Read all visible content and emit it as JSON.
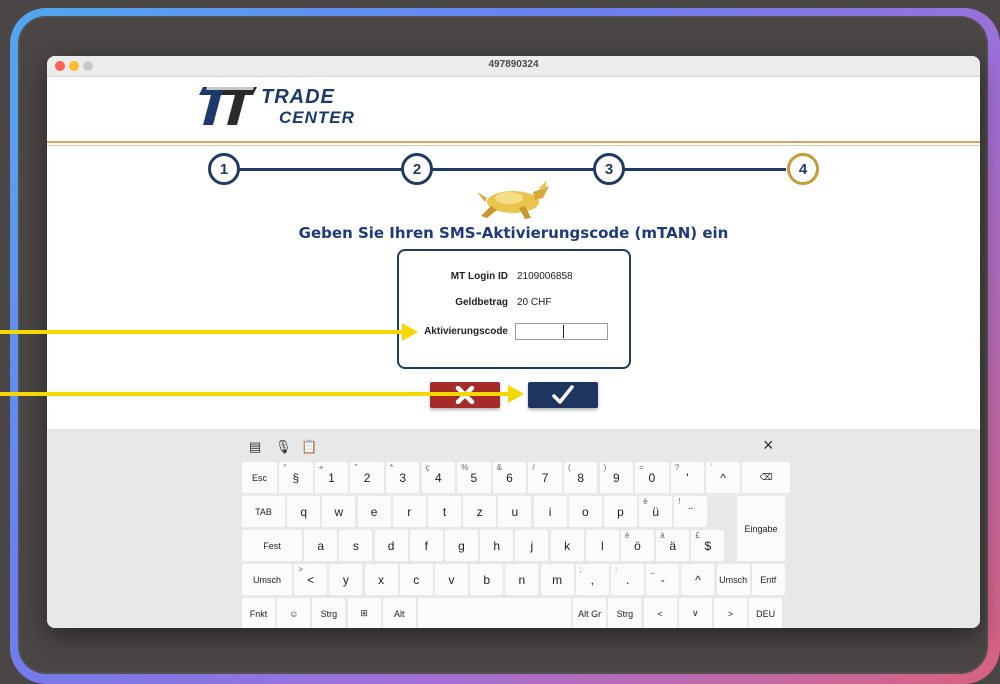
{
  "window": {
    "title": "497890324"
  },
  "logo": {
    "line1": "TRADE",
    "line2": "CENTER"
  },
  "steps": [
    "1",
    "2",
    "3",
    "4"
  ],
  "heading": "Geben Sie Ihren SMS-Aktivierungscode (mTAN) ein",
  "form": {
    "login_label": "MT Login ID",
    "login_value": "2109006858",
    "amount_label": "Geldbetrag",
    "amount_value": "20 CHF",
    "code_label": "Aktivierungscode",
    "code_value": ""
  },
  "buttons": {
    "cancel_icon": "x-icon",
    "confirm_icon": "checkmark-icon"
  },
  "keyboard": {
    "close": "×",
    "row1": [
      {
        "main": "Esc",
        "sec": ""
      },
      {
        "main": "§",
        "sec": "°"
      },
      {
        "main": "1",
        "sec": "+"
      },
      {
        "main": "2",
        "sec": "\""
      },
      {
        "main": "3",
        "sec": "*"
      },
      {
        "main": "4",
        "sec": "ç"
      },
      {
        "main": "5",
        "sec": "%"
      },
      {
        "main": "6",
        "sec": "&"
      },
      {
        "main": "7",
        "sec": "/"
      },
      {
        "main": "8",
        "sec": "("
      },
      {
        "main": "9",
        "sec": ")"
      },
      {
        "main": "0",
        "sec": "="
      },
      {
        "main": "'",
        "sec": "?"
      },
      {
        "main": "^",
        "sec": "`"
      },
      {
        "main": "⌫",
        "sec": ""
      }
    ],
    "row2": [
      {
        "main": "TAB",
        "sec": ""
      },
      {
        "main": "q",
        "sec": ""
      },
      {
        "main": "w",
        "sec": ""
      },
      {
        "main": "e",
        "sec": ""
      },
      {
        "main": "r",
        "sec": ""
      },
      {
        "main": "t",
        "sec": ""
      },
      {
        "main": "z",
        "sec": ""
      },
      {
        "main": "u",
        "sec": ""
      },
      {
        "main": "i",
        "sec": ""
      },
      {
        "main": "o",
        "sec": ""
      },
      {
        "main": "p",
        "sec": ""
      },
      {
        "main": "ü",
        "sec": "è"
      },
      {
        "main": "¨",
        "sec": "!"
      }
    ],
    "enter": "Eingabe",
    "row3": [
      {
        "main": "Fest",
        "sec": ""
      },
      {
        "main": "a",
        "sec": ""
      },
      {
        "main": "s",
        "sec": ""
      },
      {
        "main": "d",
        "sec": ""
      },
      {
        "main": "f",
        "sec": ""
      },
      {
        "main": "g",
        "sec": ""
      },
      {
        "main": "h",
        "sec": ""
      },
      {
        "main": "j",
        "sec": ""
      },
      {
        "main": "k",
        "sec": ""
      },
      {
        "main": "l",
        "sec": ""
      },
      {
        "main": "ö",
        "sec": "é"
      },
      {
        "main": "ä",
        "sec": "à"
      },
      {
        "main": "$",
        "sec": "£"
      }
    ],
    "row4": [
      {
        "main": "Umsch",
        "sec": ""
      },
      {
        "main": "<",
        "sec": ">"
      },
      {
        "main": "y",
        "sec": ""
      },
      {
        "main": "x",
        "sec": ""
      },
      {
        "main": "c",
        "sec": ""
      },
      {
        "main": "v",
        "sec": ""
      },
      {
        "main": "b",
        "sec": ""
      },
      {
        "main": "n",
        "sec": ""
      },
      {
        "main": "m",
        "sec": ""
      },
      {
        "main": ",",
        "sec": ";"
      },
      {
        "main": ".",
        "sec": ":"
      },
      {
        "main": "-",
        "sec": "_"
      },
      {
        "main": "^",
        "sec": ""
      },
      {
        "main": "Umsch",
        "sec": ""
      },
      {
        "main": "Entf",
        "sec": ""
      }
    ],
    "row5": [
      {
        "main": "Fnkt",
        "sec": ""
      },
      {
        "main": "☺",
        "sec": ""
      },
      {
        "main": "Strg",
        "sec": ""
      },
      {
        "main": "⊞",
        "sec": ""
      },
      {
        "main": "Alt",
        "sec": ""
      },
      {
        "main": "",
        "sec": ""
      },
      {
        "main": "Alt Gr",
        "sec": ""
      },
      {
        "main": "Strg",
        "sec": ""
      },
      {
        "main": "<",
        "sec": ""
      },
      {
        "main": "∨",
        "sec": ""
      },
      {
        "main": ">",
        "sec": ""
      },
      {
        "main": "DEU",
        "sec": ""
      }
    ]
  },
  "colors": {
    "navy": "#1f3a64",
    "gold": "#c79a3a",
    "cancel_red": "#a52a2a",
    "arrow_yellow": "#f5d800"
  }
}
